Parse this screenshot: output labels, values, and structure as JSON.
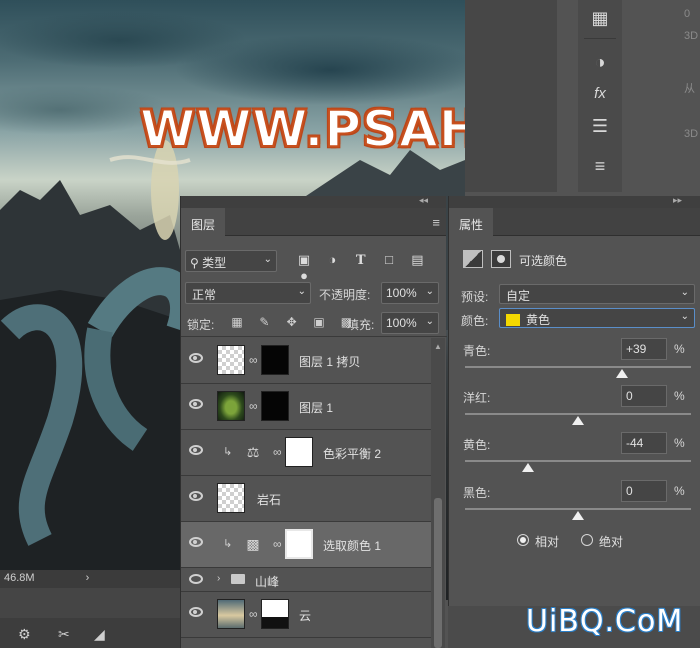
{
  "canvas": {
    "status_text": "46.8M",
    "status_arrow": "›",
    "watermark": "WWW.PSAHZ.COM"
  },
  "site_watermark": "UiBQ.CoM",
  "layers_panel": {
    "tab_label": "图层",
    "filter_label": "类型",
    "blend_mode": "正常",
    "opacity_label": "不透明度:",
    "opacity_value": "100%",
    "lock_label": "锁定:",
    "fill_label": "填充:",
    "fill_value": "100%",
    "layers": [
      {
        "name": "图层 1 拷贝"
      },
      {
        "name": "图层 1"
      },
      {
        "name": "色彩平衡 2"
      },
      {
        "name": "岩石"
      },
      {
        "name": "选取颜色 1"
      },
      {
        "name": "山峰"
      },
      {
        "name": "云"
      }
    ]
  },
  "properties_panel": {
    "tab_label": "属性",
    "title": "可选颜色",
    "preset_label": "预设:",
    "preset_value": "自定",
    "colors_label": "颜色:",
    "colors_value": "黄色",
    "swatch_color": "#f4d800",
    "sliders": [
      {
        "label": "青色:",
        "value": "+39",
        "unit": "%",
        "level": 0.695
      },
      {
        "label": "洋红:",
        "value": "0",
        "unit": "%",
        "level": 0.5
      },
      {
        "label": "黄色:",
        "value": "-44",
        "unit": "%",
        "level": 0.28
      },
      {
        "label": "黑色:",
        "value": "0",
        "unit": "%",
        "level": 0.5
      }
    ],
    "method_relative": "相对",
    "method_absolute": "绝对"
  },
  "right_ghost_text": [
    "0",
    "3D",
    "从",
    "3D"
  ]
}
